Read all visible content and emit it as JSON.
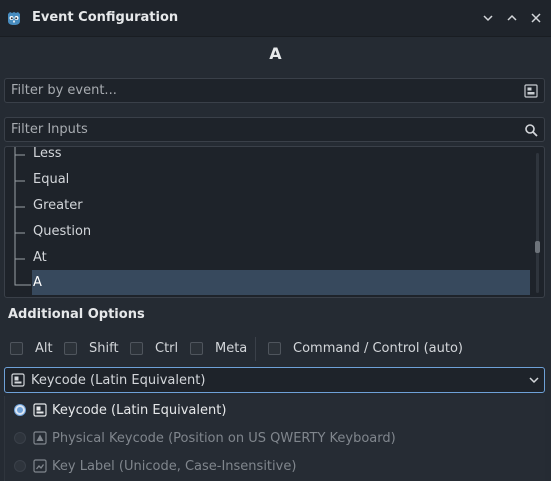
{
  "window": {
    "title": "Event Configuration",
    "controls": [
      "minimize-icon",
      "maximize-icon",
      "close-icon"
    ]
  },
  "event_name": "A",
  "event_filter": {
    "placeholder": "Filter by event...",
    "value": ""
  },
  "inputs_filter": {
    "placeholder": "Filter Inputs",
    "value": ""
  },
  "tree": {
    "items": [
      {
        "label": "Less",
        "selected": false
      },
      {
        "label": "Equal",
        "selected": false
      },
      {
        "label": "Greater",
        "selected": false
      },
      {
        "label": "Question",
        "selected": false
      },
      {
        "label": "At",
        "selected": false
      },
      {
        "label": "A",
        "selected": true
      }
    ]
  },
  "additional_options": {
    "title": "Additional Options",
    "modifiers": [
      {
        "label": "Alt",
        "checked": false
      },
      {
        "label": "Shift",
        "checked": false
      },
      {
        "label": "Ctrl",
        "checked": false
      },
      {
        "label": "Meta",
        "checked": false
      },
      {
        "label": "Command / Control (auto)",
        "checked": false
      }
    ]
  },
  "keycode_select": {
    "selected": "Keycode (Latin Equivalent)",
    "options": [
      {
        "label": "Keycode (Latin Equivalent)",
        "selected": true,
        "enabled": true
      },
      {
        "label": "Physical Keycode (Position on US QWERTY Keyboard)",
        "selected": false,
        "enabled": false
      },
      {
        "label": "Key Label (Unicode, Case-Insensitive)",
        "selected": false,
        "enabled": false
      }
    ]
  },
  "colors": {
    "accent": "#6ea1d8",
    "selection": "#37495d",
    "background": "#252b33"
  }
}
